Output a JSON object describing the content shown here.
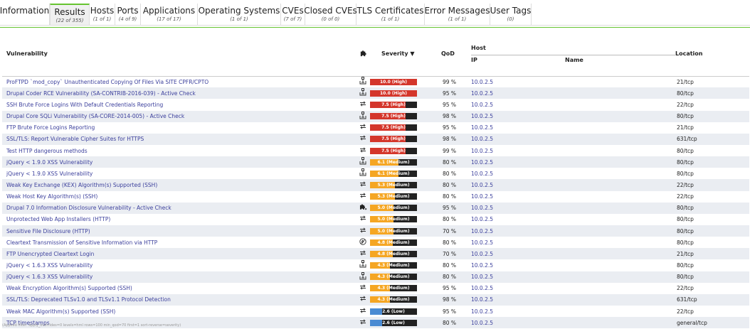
{
  "tabs": [
    {
      "label": "Information",
      "count": "",
      "active": false
    },
    {
      "label": "Results",
      "count": "(22 of 355)",
      "active": true
    },
    {
      "label": "Hosts",
      "count": "(1 of 1)",
      "active": false
    },
    {
      "label": "Ports",
      "count": "(4 of 9)",
      "active": false
    },
    {
      "label": "Applications",
      "count": "(17 of 17)",
      "active": false
    },
    {
      "label": "Operating Systems",
      "count": "(1 of 1)",
      "active": false
    },
    {
      "label": "CVEs",
      "count": "(7 of 7)",
      "active": false
    },
    {
      "label": "Closed CVEs",
      "count": "(0 of 0)",
      "active": false
    },
    {
      "label": "TLS Certificates",
      "count": "(1 of 1)",
      "active": false
    },
    {
      "label": "Error Messages",
      "count": "(1 of 1)",
      "active": false
    },
    {
      "label": "User Tags",
      "count": "(0)",
      "active": false
    }
  ],
  "table": {
    "headers": {
      "vulnerability": "Vulnerability",
      "severity": "Severity",
      "sort_arrow": "▼",
      "qod": "QoD",
      "host": "Host",
      "ip": "IP",
      "name": "Name",
      "location": "Location"
    },
    "rows": [
      {
        "vuln": "ProFTPD `mod_copy` Unauthenticated Copying Of Files Via SITE CPFR/CPTO",
        "solution": "vendorfix",
        "severity": "10.0 (High)",
        "score": 10.0,
        "level": "high",
        "qod": "99 %",
        "ip": "10.0.2.5",
        "name": "",
        "location": "21/tcp"
      },
      {
        "vuln": "Drupal Coder RCE Vulnerability (SA-CONTRIB-2016-039) - Active Check",
        "solution": "vendorfix",
        "severity": "10.0 (High)",
        "score": 10.0,
        "level": "high",
        "qod": "95 %",
        "ip": "10.0.2.5",
        "name": "",
        "location": "80/tcp"
      },
      {
        "vuln": "SSH Brute Force Logins With Default Credentials Reporting",
        "solution": "mitigation",
        "severity": "7.5 (High)",
        "score": 7.5,
        "level": "high",
        "qod": "95 %",
        "ip": "10.0.2.5",
        "name": "",
        "location": "22/tcp"
      },
      {
        "vuln": "Drupal Core SQLi Vulnerability (SA-CORE-2014-005) - Active Check",
        "solution": "vendorfix",
        "severity": "7.5 (High)",
        "score": 7.5,
        "level": "high",
        "qod": "98 %",
        "ip": "10.0.2.5",
        "name": "",
        "location": "80/tcp"
      },
      {
        "vuln": "FTP Brute Force Logins Reporting",
        "solution": "mitigation",
        "severity": "7.5 (High)",
        "score": 7.5,
        "level": "high",
        "qod": "95 %",
        "ip": "10.0.2.5",
        "name": "",
        "location": "21/tcp"
      },
      {
        "vuln": "SSL/TLS: Report Vulnerable Cipher Suites for HTTPS",
        "solution": "mitigation",
        "severity": "7.5 (High)",
        "score": 7.5,
        "level": "high",
        "qod": "98 %",
        "ip": "10.0.2.5",
        "name": "",
        "location": "631/tcp"
      },
      {
        "vuln": "Test HTTP dangerous methods",
        "solution": "mitigation",
        "severity": "7.5 (High)",
        "score": 7.5,
        "level": "high",
        "qod": "99 %",
        "ip": "10.0.2.5",
        "name": "",
        "location": "80/tcp"
      },
      {
        "vuln": "jQuery < 1.9.0 XSS Vulnerability",
        "solution": "vendorfix",
        "severity": "6.1 (Medium)",
        "score": 6.1,
        "level": "medium",
        "qod": "80 %",
        "ip": "10.0.2.5",
        "name": "",
        "location": "80/tcp"
      },
      {
        "vuln": "jQuery < 1.9.0 XSS Vulnerability",
        "solution": "vendorfix",
        "severity": "6.1 (Medium)",
        "score": 6.1,
        "level": "medium",
        "qod": "80 %",
        "ip": "10.0.2.5",
        "name": "",
        "location": "80/tcp"
      },
      {
        "vuln": "Weak Key Exchange (KEX) Algorithm(s) Supported (SSH)",
        "solution": "mitigation",
        "severity": "5.3 (Medium)",
        "score": 5.3,
        "level": "medium",
        "qod": "80 %",
        "ip": "10.0.2.5",
        "name": "",
        "location": "22/tcp"
      },
      {
        "vuln": "Weak Host Key Algorithm(s) (SSH)",
        "solution": "mitigation",
        "severity": "5.3 (Medium)",
        "score": 5.3,
        "level": "medium",
        "qod": "80 %",
        "ip": "10.0.2.5",
        "name": "",
        "location": "22/tcp"
      },
      {
        "vuln": "Drupal 7.0 Information Disclosure Vulnerability - Active Check",
        "solution": "workaround",
        "severity": "5.0 (Medium)",
        "score": 5.0,
        "level": "medium",
        "qod": "95 %",
        "ip": "10.0.2.5",
        "name": "",
        "location": "80/tcp"
      },
      {
        "vuln": "Unprotected Web App Installers (HTTP)",
        "solution": "mitigation",
        "severity": "5.0 (Medium)",
        "score": 5.0,
        "level": "medium",
        "qod": "80 %",
        "ip": "10.0.2.5",
        "name": "",
        "location": "80/tcp"
      },
      {
        "vuln": "Sensitive File Disclosure (HTTP)",
        "solution": "mitigation",
        "severity": "5.0 (Medium)",
        "score": 5.0,
        "level": "medium",
        "qod": "70 %",
        "ip": "10.0.2.5",
        "name": "",
        "location": "80/tcp"
      },
      {
        "vuln": "Cleartext Transmission of Sensitive Information via HTTP",
        "solution": "willnotfix",
        "severity": "4.8 (Medium)",
        "score": 4.8,
        "level": "medium",
        "qod": "80 %",
        "ip": "10.0.2.5",
        "name": "",
        "location": "80/tcp"
      },
      {
        "vuln": "FTP Unencrypted Cleartext Login",
        "solution": "mitigation",
        "severity": "4.8 (Medium)",
        "score": 4.8,
        "level": "medium",
        "qod": "70 %",
        "ip": "10.0.2.5",
        "name": "",
        "location": "21/tcp"
      },
      {
        "vuln": "jQuery < 1.6.3 XSS Vulnerability",
        "solution": "vendorfix",
        "severity": "4.3 (Medium)",
        "score": 4.3,
        "level": "medium",
        "qod": "80 %",
        "ip": "10.0.2.5",
        "name": "",
        "location": "80/tcp"
      },
      {
        "vuln": "jQuery < 1.6.3 XSS Vulnerability",
        "solution": "vendorfix",
        "severity": "4.3 (Medium)",
        "score": 4.3,
        "level": "medium",
        "qod": "80 %",
        "ip": "10.0.2.5",
        "name": "",
        "location": "80/tcp"
      },
      {
        "vuln": "Weak Encryption Algorithm(s) Supported (SSH)",
        "solution": "mitigation",
        "severity": "4.3 (Medium)",
        "score": 4.3,
        "level": "medium",
        "qod": "95 %",
        "ip": "10.0.2.5",
        "name": "",
        "location": "22/tcp"
      },
      {
        "vuln": "SSL/TLS: Deprecated TLSv1.0 and TLSv1.1 Protocol Detection",
        "solution": "mitigation",
        "severity": "4.3 (Medium)",
        "score": 4.3,
        "level": "medium",
        "qod": "98 %",
        "ip": "10.0.2.5",
        "name": "",
        "location": "631/tcp"
      },
      {
        "vuln": "Weak MAC Algorithm(s) Supported (SSH)",
        "solution": "mitigation",
        "severity": "2.6 (Low)",
        "score": 2.6,
        "level": "low",
        "qod": "95 %",
        "ip": "10.0.2.5",
        "name": "",
        "location": "22/tcp"
      },
      {
        "vuln": "TCP timestamps",
        "solution": "mitigation",
        "severity": "2.6 (Low)",
        "score": 2.6,
        "level": "low",
        "qod": "80 %",
        "ip": "10.0.2.5",
        "name": "",
        "location": "general/tcp"
      }
    ]
  },
  "colors": {
    "high": "#d4362b",
    "medium": "#f5a623",
    "low": "#4a8bd3",
    "track": "#222222",
    "active_tab_accent": "#66c430",
    "link": "#3b3f9c"
  },
  "icons": {
    "solution_column": "puzzle-icon",
    "vendorfix": "vendorfix-icon",
    "mitigation": "mitigation-icon",
    "workaround": "workaround-icon",
    "willnotfix": "willnotfix-icon"
  },
  "footer": {
    "applied_filter": "(Applied filter: apply_overrides=0 levels=hml rows=100 min_qod=70 first=1 sort-reverse=severity)"
  }
}
